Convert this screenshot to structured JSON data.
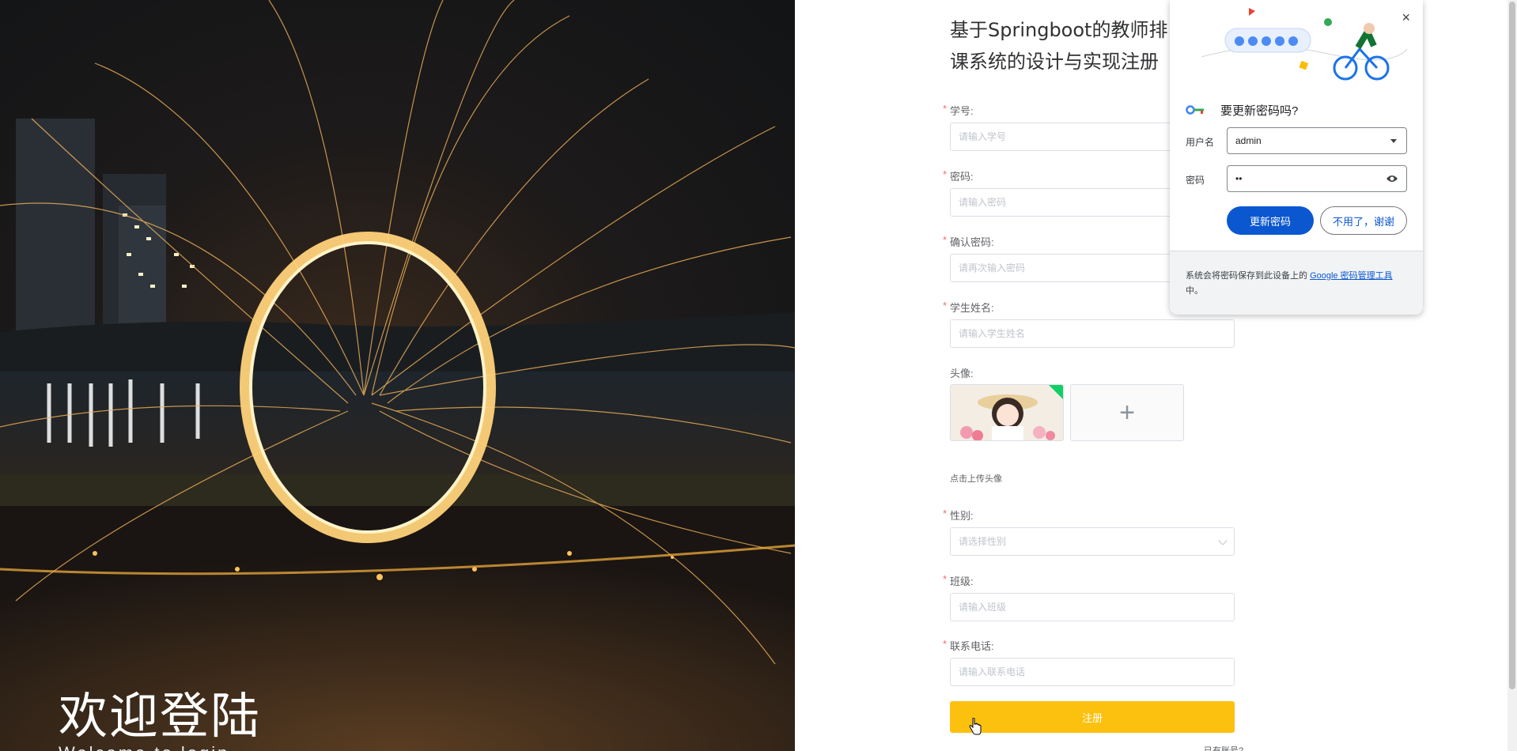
{
  "hero": {
    "title": "欢迎登陆",
    "subtitle": "Welcome to login"
  },
  "form": {
    "title": "基于Springboot的教师排课系统的设计与实现注册",
    "fields": [
      {
        "label": "学号:",
        "placeholder": "请输入学号",
        "required": true
      },
      {
        "label": "密码:",
        "placeholder": "请输入密码",
        "required": true
      },
      {
        "label": "确认密码:",
        "placeholder": "请再次输入密码",
        "required": true
      },
      {
        "label": "学生姓名:",
        "placeholder": "请输入学生姓名",
        "required": true
      }
    ],
    "avatar": {
      "label": "头像:",
      "upload_hint": "点击上传头像",
      "plus": "+"
    },
    "gender": {
      "label": "性别:",
      "placeholder": "请选择性别",
      "required": true
    },
    "class_field": {
      "label": "班级:",
      "placeholder": "请输入班级",
      "required": true
    },
    "phone": {
      "label": "联系电话:",
      "placeholder": "请输入联系电话",
      "required": true
    },
    "submit_label": "注册",
    "login_link": "已有账号?登录",
    "required_mark": "*"
  },
  "password_popup": {
    "title": "要更新密码吗?",
    "close": "×",
    "username_label": "用户名",
    "username_value": "admin",
    "password_label": "密码",
    "password_value": "••",
    "update_button": "更新密码",
    "decline_button": "不用了，谢谢",
    "footer_text": "系统会将密码保存到此设备上的 ",
    "footer_link": "Google 密码管理工具",
    "footer_suffix": "中。"
  },
  "colors": {
    "submit": "#fcc10f",
    "required": "#f56c6c",
    "popup_primary": "#0b57d0"
  }
}
